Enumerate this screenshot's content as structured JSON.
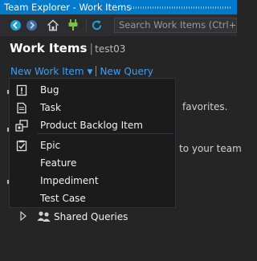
{
  "window": {
    "title": "Team Explorer - Work Items"
  },
  "toolbar": {
    "icons": [
      "back-icon",
      "forward-icon",
      "home-icon",
      "connect-icon",
      "refresh-icon"
    ],
    "search": {
      "placeholder": "Search Work Items (Ctrl+I)"
    }
  },
  "header": {
    "title": "Work Items",
    "separator": "|",
    "project": "test03"
  },
  "links": {
    "new_work_item": "New Work Item",
    "new_query": "New Query"
  },
  "background": {
    "favorites_text": "favorites.",
    "team_text": "to your team",
    "shared_queries": "Shared Queries"
  },
  "menu": {
    "items": [
      {
        "label": "Bug",
        "icon": "bug-icon"
      },
      {
        "label": "Task",
        "icon": "task-icon"
      },
      {
        "label": "Product Backlog Item",
        "icon": "backlog-item-icon"
      },
      {
        "label": "Epic",
        "icon": "epic-icon"
      },
      {
        "label": "Feature",
        "icon": ""
      },
      {
        "label": "Impediment",
        "icon": ""
      },
      {
        "label": "Test Case",
        "icon": ""
      }
    ]
  },
  "colors": {
    "accent": "#007acc",
    "link": "#3e9ef0",
    "background": "#252526"
  }
}
